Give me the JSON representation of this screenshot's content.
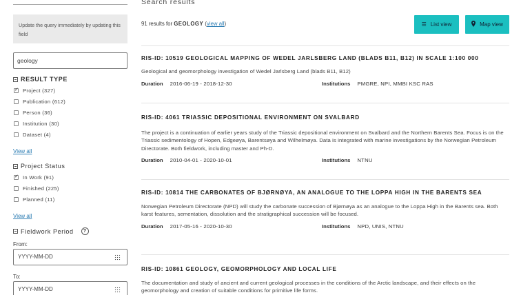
{
  "sidebar": {
    "hint": "Update the query immediately by updating this field",
    "query_value": "geology",
    "result_type": {
      "title": "RESULT TYPE",
      "options": [
        {
          "label": "Project (327)",
          "checked": true
        },
        {
          "label": "Publication (612)",
          "checked": false
        },
        {
          "label": "Person (36)",
          "checked": false
        },
        {
          "label": "Institution (30)",
          "checked": false
        },
        {
          "label": "Dataset (4)",
          "checked": false
        }
      ],
      "view_all": "View all"
    },
    "project_status": {
      "title": "Project Status",
      "options": [
        {
          "label": "In Work (91)",
          "checked": true
        },
        {
          "label": "Finished (225)",
          "checked": false
        },
        {
          "label": "Planned (11)",
          "checked": false
        }
      ],
      "view_all": "View all"
    },
    "fieldwork_period": {
      "title": "Fieldwork Period",
      "help_glyph": "?",
      "from_label": "From:",
      "from_placeholder": "YYYY-MM-DD",
      "to_label": "To:",
      "to_placeholder": "YYYY-MM-DD"
    }
  },
  "main": {
    "heading": "Search results",
    "count_prefix": "91 results for ",
    "query": "GEOLOGY",
    "view_all_link": "view all",
    "list_view_label": "List view",
    "map_view_label": "Map view",
    "duration_label": "Duration",
    "institutions_label": "Institutions",
    "results": [
      {
        "title": "RIS-ID: 10519 GEOLOGICAL MAPPING OF WEDEL JARLSBERG LAND (BLADS B11, B12) IN SCALE 1:100 000",
        "description": "Geological and geomorphology investigation of Wedel Jarlsberg Land (blads B11, B12)",
        "duration": "2016-06-19 - 2018-12-30",
        "institutions": "PMGRE, NPI, MMBI KSC RAS"
      },
      {
        "title": "RIS-ID: 4061 TRIASSIC DEPOSITIONAL ENVIRONMENT ON SVALBARD",
        "description": "The project is a continuation of earlier years study of the Triassic depositional environment on Svalbard and the Northern Barents Sea. Focus is on the Triassic sedimentology of Hopen, Edgeøya, Barentsøya and Wilhelmøya. Data is integrated with marine investigations by the Norwegian Petroleum Directorate. Both fieldwork, including master and Ph-D.",
        "duration": "2010-04-01 - 2020-10-01",
        "institutions": "NTNU"
      },
      {
        "title": "RIS-ID: 10814 THE CARBONATES OF BJØRNØYA, AN ANALOGUE TO THE LOPPA HIGH IN THE BARENTS SEA",
        "description": "Norwegian Petroleum Directorate (NPD) will study the carbonate succession of Bjørnøya as an analogue to the Loppa High in the Barents sea. Both karst features, sementation, dissolution and the stratigraphical succession will be focused.",
        "duration": "2017-05-16 - 2020-10-30",
        "institutions": "NPD, UNIS, NTNU"
      },
      {
        "title": "RIS-ID: 10861 GEOLOGY, GEOMORPHOLOGY AND LOCAL LIFE",
        "description": "The documentation and study of ancient and current geological processes in the conditions of the Arctic landscape, and their effects on the geomorphology and creation of suitable conditions for primitive life forms."
      }
    ]
  }
}
